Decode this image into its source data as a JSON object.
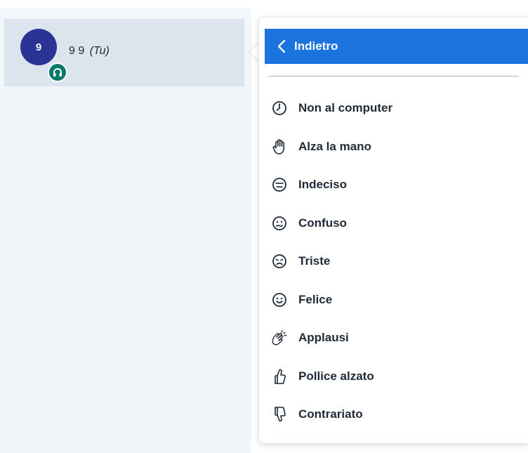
{
  "user_list": {
    "users": [
      {
        "avatar_initial": "9",
        "name": "9 9",
        "you_suffix": "(Tu)",
        "avatar_color": "#2a3496",
        "status_badge_icon": "headphones-icon",
        "status_badge_color": "#0b7a6a"
      }
    ]
  },
  "menu": {
    "back": {
      "label": "Indietro",
      "icon": "chevron-left-icon",
      "color": "#1b73e0"
    },
    "items": [
      {
        "label": "Non al computer",
        "icon": "clock-icon"
      },
      {
        "label": "Alza la mano",
        "icon": "raised-hand-icon"
      },
      {
        "label": "Indeciso",
        "icon": "neutral-face-icon"
      },
      {
        "label": "Confuso",
        "icon": "confused-face-icon"
      },
      {
        "label": "Triste",
        "icon": "sad-face-icon"
      },
      {
        "label": "Felice",
        "icon": "happy-face-icon"
      },
      {
        "label": "Applausi",
        "icon": "clapping-hands-icon"
      },
      {
        "label": "Pollice alzato",
        "icon": "thumbs-up-icon"
      },
      {
        "label": "Contrariato",
        "icon": "thumbs-down-icon"
      }
    ]
  }
}
